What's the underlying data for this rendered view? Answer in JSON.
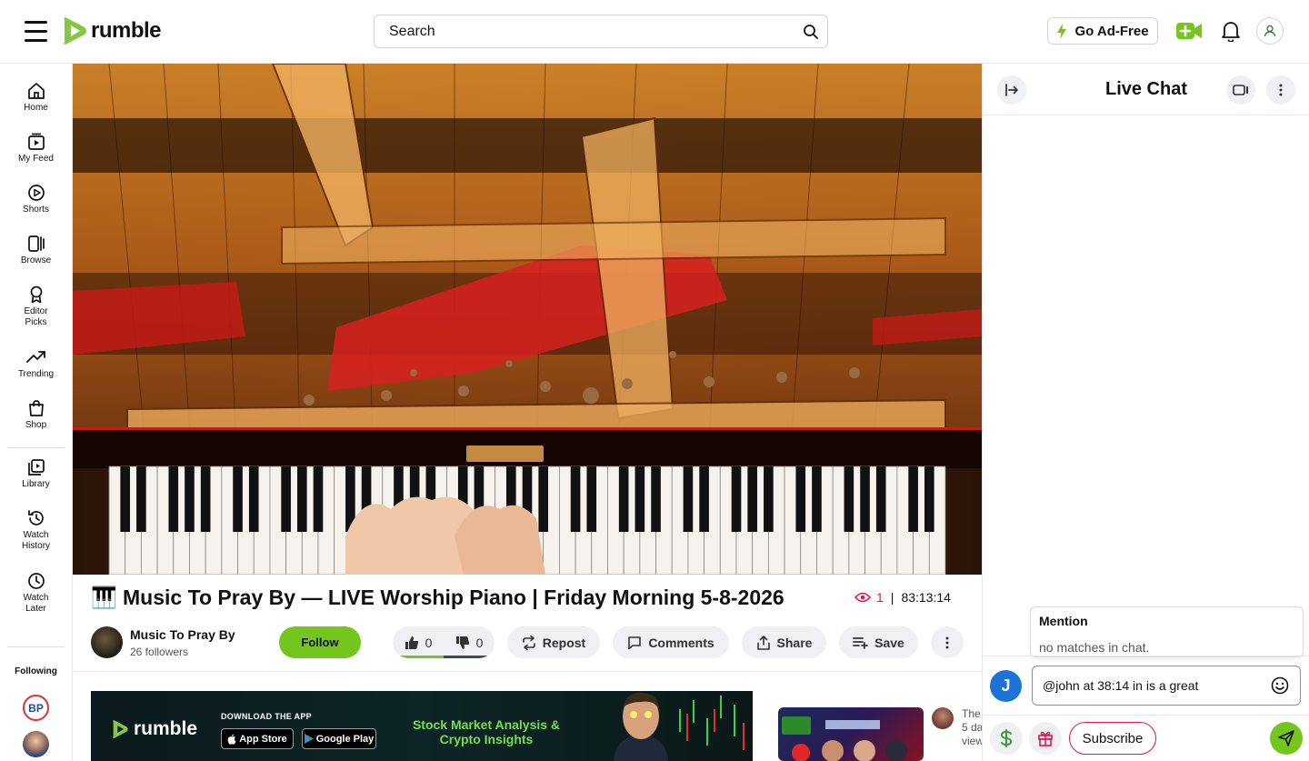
{
  "header": {
    "logo_text": "rumble",
    "search_placeholder": "Search",
    "ad_free_label": "Go Ad-Free"
  },
  "sidebar": {
    "items": [
      {
        "label": "Home",
        "icon": "home-icon"
      },
      {
        "label": "My Feed",
        "icon": "feed-icon"
      },
      {
        "label": "Shorts",
        "icon": "shorts-icon"
      },
      {
        "label": "Browse",
        "icon": "browse-icon"
      },
      {
        "label": "Editor Picks",
        "icon": "award-icon"
      },
      {
        "label": "Trending",
        "icon": "trending-icon"
      },
      {
        "label": "Shop",
        "icon": "shop-icon"
      },
      {
        "label": "Library",
        "icon": "library-icon"
      },
      {
        "label": "Watch History",
        "icon": "history-icon"
      },
      {
        "label": "Watch Later",
        "icon": "clock-icon"
      }
    ],
    "following_label": "Following",
    "following_avatar_1_text": "BP"
  },
  "video": {
    "title": "🎹 Music To Pray By — LIVE Worship Piano | Friday Morning 5-8-2026",
    "viewers": "1",
    "duration": "83:13:14",
    "channel_name": "Music To Pray By",
    "followers": "26 followers",
    "follow_label": "Follow",
    "likes": "0",
    "dislikes": "0",
    "repost_label": "Repost",
    "comments_label": "Comments",
    "share_label": "Share",
    "save_label": "Save"
  },
  "ad": {
    "brand": "rumble",
    "download_label": "DOWNLOAD THE APP",
    "app_store": "App Store",
    "google_play": "Google Play",
    "tagline": "Stock Market Analysis & Crypto Insights"
  },
  "recommendation": {
    "text_line1": "The",
    "text_line2": "5 da",
    "text_line3": "view"
  },
  "chat": {
    "title": "Live Chat",
    "mention_title": "Mention",
    "mention_empty": "no matches in chat.",
    "user_initial": "J",
    "input_value": "@john at 38:14 in is a great",
    "subscribe_label": "Subscribe"
  },
  "colors": {
    "brand_green": "#74c51c",
    "accent_red": "#e3164f",
    "user_blue": "#1e73d8"
  }
}
